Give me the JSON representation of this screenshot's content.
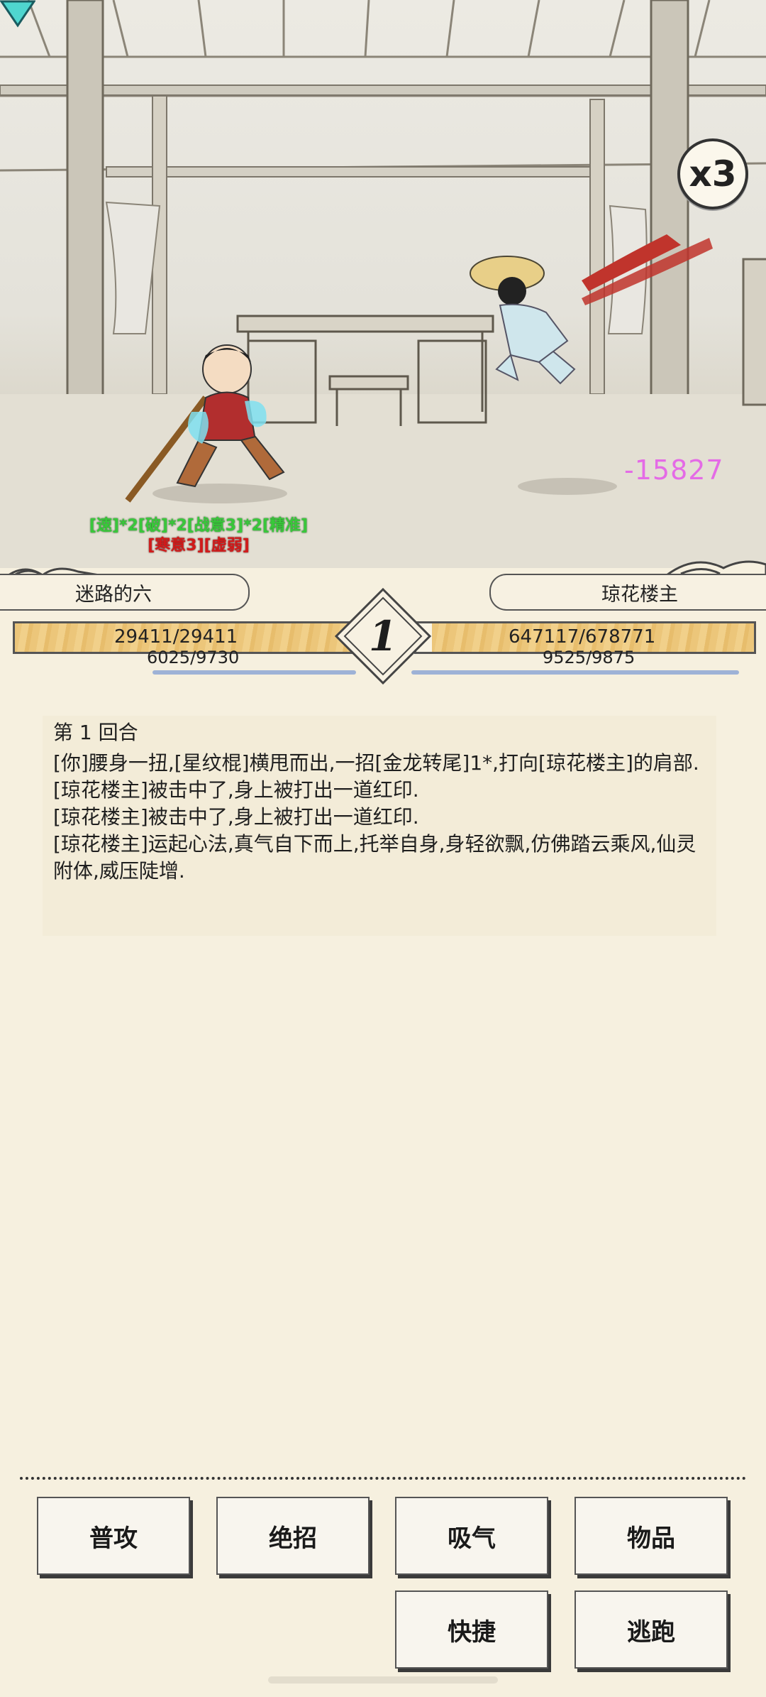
{
  "battle": {
    "speed_multiplier": "x3",
    "damage_popup": "-15827",
    "player_buffs": "[速]*2[破]*2[战意3]*2[精准]",
    "player_debuffs": "[寒意3][虚弱]"
  },
  "player": {
    "name": "迷路的六",
    "hp_text": "29411/29411",
    "hp_fraction": 1.0,
    "mp_text": "6025/9730"
  },
  "enemy": {
    "name": "琼花楼主",
    "hp_text": "647117/678771",
    "hp_fraction": 0.953,
    "mp_text": "9525/9875"
  },
  "round_indicator": "1",
  "log": {
    "title": "第 1 回合",
    "entries": [
      "[你]腰身一扭,[星纹棍]横甩而出,一招[金龙转尾]1*,打向[琼花楼主]的肩部.",
      "[琼花楼主]被击中了,身上被打出一道红印.",
      "[琼花楼主]被击中了,身上被打出一道红印.",
      "[琼花楼主]运起心法,真气自下而上,托举自身,身轻欲飘,仿佛踏云乘风,仙灵附体,威压陡增."
    ]
  },
  "actions": {
    "attack": "普攻",
    "ultimate": "绝招",
    "breathe": "吸气",
    "items": "物品",
    "shortcut": "快捷",
    "flee": "逃跑"
  },
  "colors": {
    "hp_bar": "#ecc67a",
    "mp_line": "#9eb2d6",
    "damage": "#e46be6",
    "buff": "#38c83a",
    "debuff": "#d21a1a"
  }
}
